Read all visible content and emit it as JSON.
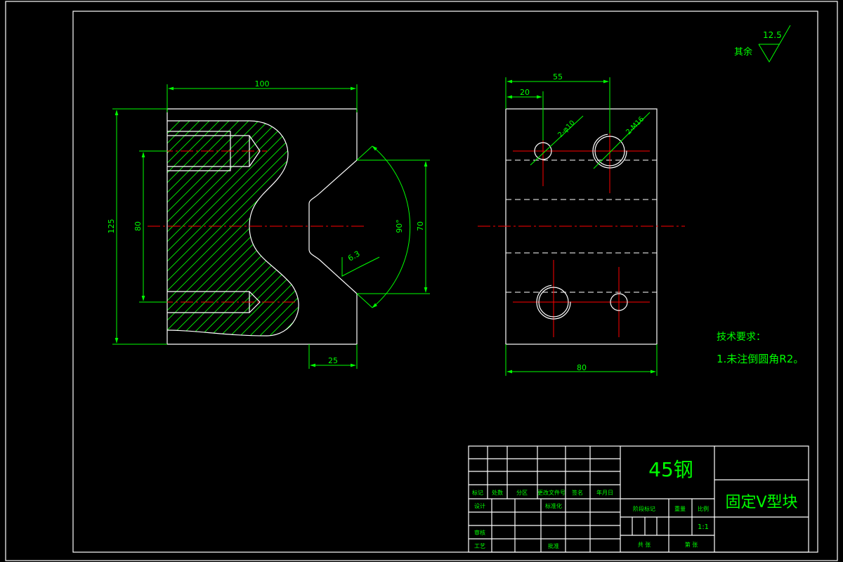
{
  "roughness": {
    "label": "其余",
    "value": "12.5"
  },
  "left_view": {
    "dim_width": "100",
    "dim_height": "125",
    "dim_inner": "80",
    "dim_bottom": "25",
    "dim_v": "70",
    "angle": "90°",
    "surface": "6.3"
  },
  "right_view": {
    "dim_top": "55",
    "dim_left": "20",
    "dim_bottom": "80",
    "hole_small": "2-φ10",
    "hole_large": "2-M16"
  },
  "tech_req": {
    "title": "技术要求：",
    "item": "1.未注倒圆角R2。"
  },
  "title_block": {
    "material": "45钢",
    "part_name": "固定V型块",
    "scale": "1:1",
    "labels": {
      "mark": "标记",
      "count": "处数",
      "zone": "分区",
      "doc_no": "更改文件号",
      "sign": "签名",
      "date": "年月日",
      "design": "设计",
      "std": "标准化",
      "stage_mark": "阶段标记",
      "weight": "重量",
      "ratio": "比例",
      "review": "审核",
      "process": "工艺",
      "approve": "批准",
      "sheets_total": "共 张",
      "sheet_no": "第 张"
    }
  }
}
